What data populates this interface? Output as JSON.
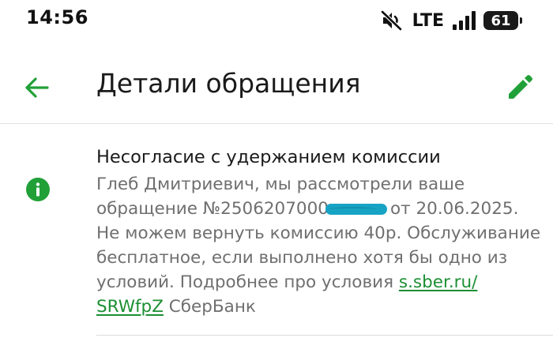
{
  "status_bar": {
    "time": "14:56",
    "network": "LTE",
    "battery": "61"
  },
  "header": {
    "title": "Детали обращения"
  },
  "appeal": {
    "title": "Несогласие с удержанием комиссии",
    "line1": "Глеб Дмитриевич, мы рассмотрели ваше",
    "line2_before": "обращение №2506207000",
    "line2_after": "от 20.06.2025.",
    "line3": "Не можем вернуть комиссию 40р. Обслуживание",
    "line4": "бесплатное, если выполнено хотя бы одно из",
    "line5_before": "условий. Подробнее про условия ",
    "link_part1": "s.sber.ru/",
    "link_part2": "SRWfpZ",
    "line6_after": " СберБанк"
  },
  "colors": {
    "accent": "#21a038",
    "link": "#1c8f33",
    "body_text": "#6f6f6f",
    "redaction": "#17a3c4"
  }
}
